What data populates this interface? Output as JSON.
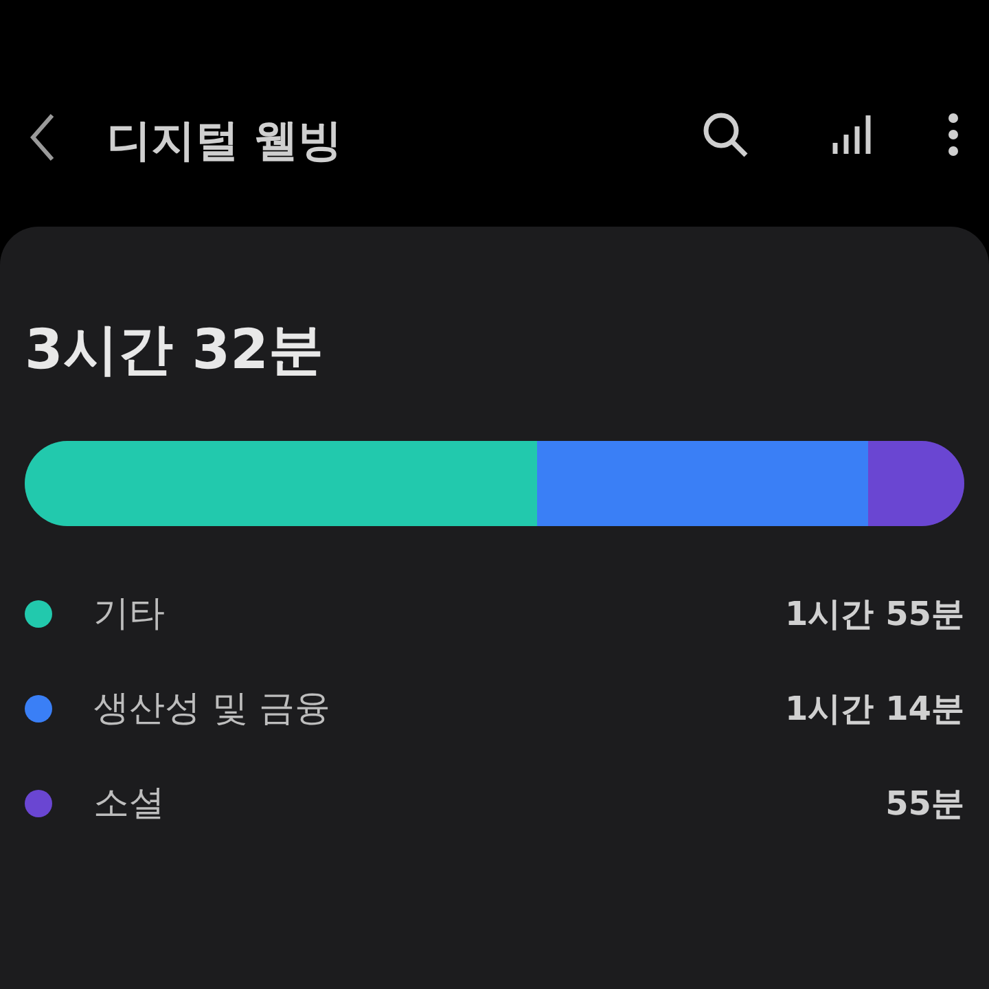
{
  "header": {
    "title": "디지털 웰빙"
  },
  "summary": {
    "total": "3시간 32분"
  },
  "categories": [
    {
      "label": "기타",
      "value": "1시간 55분",
      "color": "#22c9ad"
    },
    {
      "label": "생산성 및 금융",
      "value": "1시간 14분",
      "color": "#3a7ff6"
    },
    {
      "label": "소셜",
      "value": "55분",
      "color": "#6a46d2"
    }
  ]
}
